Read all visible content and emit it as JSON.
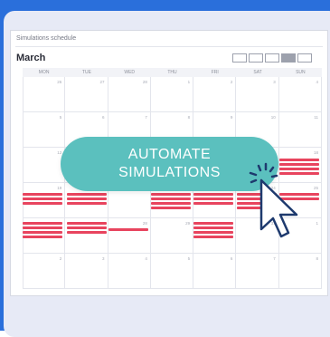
{
  "card": {
    "title": "Simulations schedule",
    "month": "March"
  },
  "calendar": {
    "days_of_week": [
      "MON",
      "TUE",
      "WED",
      "THU",
      "FRI",
      "SAT",
      "SUN"
    ],
    "weeks": [
      [
        "26",
        "27",
        "28",
        "1",
        "2",
        "3",
        "4"
      ],
      [
        "5",
        "6",
        "7",
        "8",
        "9",
        "10",
        "11"
      ],
      [
        "12",
        "13",
        "14",
        "15",
        "16",
        "17",
        "18"
      ],
      [
        "19",
        "20",
        "21",
        "22",
        "23",
        "24",
        "25"
      ],
      [
        "26",
        "27",
        "28",
        "29",
        "30",
        "31",
        "1"
      ],
      [
        "2",
        "3",
        "4",
        "5",
        "6",
        "7",
        "8"
      ]
    ],
    "view_buttons": [
      "view-1",
      "view-2",
      "view-3",
      "view-4",
      "view-5"
    ],
    "active_view_index": 3
  },
  "cta": {
    "line1": "AUTOMATE",
    "line2": "SIMULATIONS"
  },
  "colors": {
    "brand_blue": "#2a6fdb",
    "event_red": "#e8445e",
    "cta_teal": "#5bc0be",
    "cursor_navy": "#1e3a6e"
  }
}
